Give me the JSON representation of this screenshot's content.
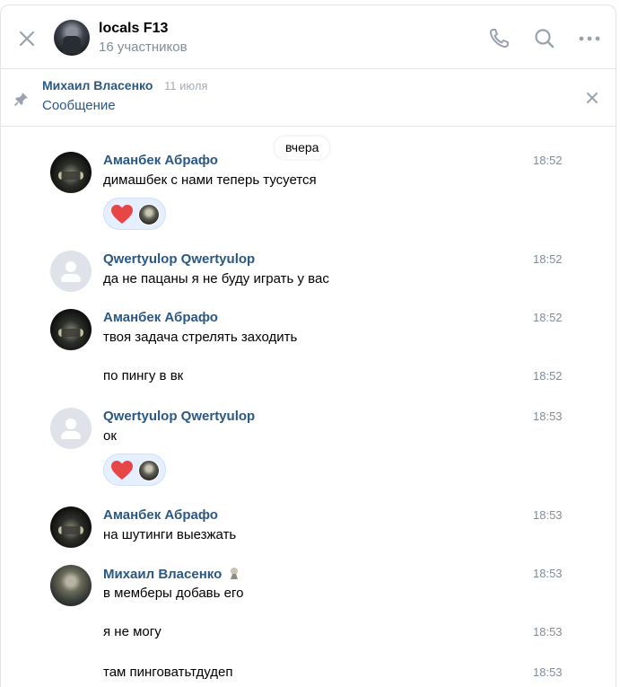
{
  "header": {
    "title": "locals F13",
    "subtitle": "16 участников"
  },
  "pinned": {
    "author": "Михаил Власенко",
    "date": "11 июля",
    "text": "Сообщение"
  },
  "date_separator": "вчера",
  "messages": [
    {
      "author": "Аманбек Абрафо",
      "avatar": "car",
      "time": "18:52",
      "text": "димашбек с нами теперь тусуется",
      "reaction": "heart"
    },
    {
      "author": "Qwertyulop Qwertyulop",
      "avatar": "default",
      "time": "18:52",
      "text": "да не пацаны я не буду играть у вас"
    },
    {
      "author": "Аманбек Абрафо",
      "avatar": "car",
      "time": "18:52",
      "text": "твоя задача стрелять заходить"
    },
    {
      "time": "18:52",
      "text": "по пингу в вк"
    },
    {
      "author": "Qwertyulop Qwertyulop",
      "avatar": "default",
      "time": "18:53",
      "text": "ок",
      "reaction": "heart"
    },
    {
      "author": "Аманбек Абрафо",
      "avatar": "car",
      "time": "18:53",
      "text": "на шутинги выезжать"
    },
    {
      "author": "Михаил Власенко",
      "avatar": "soldier",
      "time": "18:53",
      "text": "в мемберы добавь его"
    },
    {
      "time": "18:53",
      "text": "я не могу"
    },
    {
      "time": "18:53",
      "text": "там пинговатьтдудеп"
    }
  ],
  "colors": {
    "accent": "#2a5885",
    "muted": "#818c99",
    "reaction_bg": "#e5efff",
    "heart": "#e64646"
  }
}
